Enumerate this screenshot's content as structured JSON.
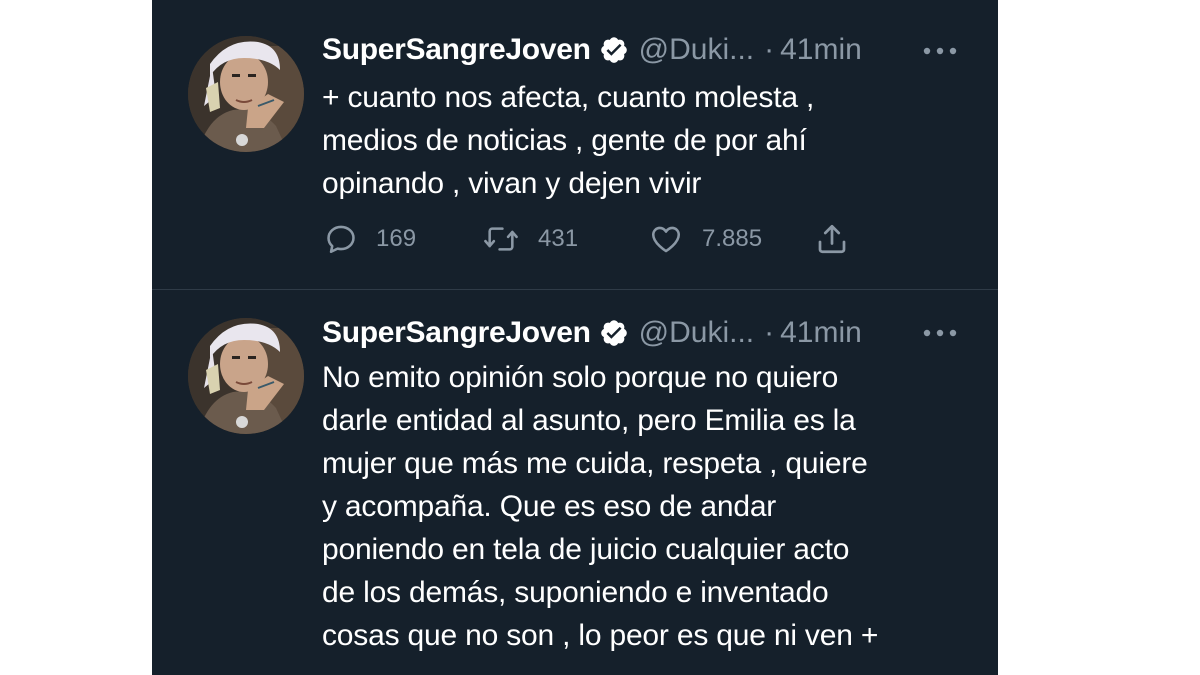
{
  "colors": {
    "background": "#15202b",
    "text_primary": "#ffffff",
    "text_secondary": "#8b98a5",
    "verified_badge": "#ffffff",
    "divider": "#2f3b47"
  },
  "tweets": [
    {
      "author": {
        "display_name": "SuperSangreJoven",
        "verified_icon": "verified-badge-icon",
        "handle": "@Duki...",
        "separator": "·",
        "time": "41min"
      },
      "more_icon": "more-options-icon",
      "text": "+ cuanto nos afecta, cuanto molesta ,\nmedios de noticias , gente de por ahí\nopinando , vivan y dejen vivir",
      "actions": {
        "reply": {
          "icon": "reply-icon",
          "count": "169"
        },
        "retweet": {
          "icon": "retweet-icon",
          "count": "431"
        },
        "like": {
          "icon": "heart-icon",
          "count": "7.885"
        },
        "share": {
          "icon": "share-icon"
        }
      }
    },
    {
      "author": {
        "display_name": "SuperSangreJoven",
        "verified_icon": "verified-badge-icon",
        "handle": "@Duki...",
        "separator": "·",
        "time": "41min"
      },
      "more_icon": "more-options-icon",
      "text": "No emito opinión solo porque no quiero\ndarle entidad al asunto, pero Emilia es la\nmujer que más me cuida, respeta , quiere\ny acompaña. Que es eso de andar\nponiendo en tela de juicio cualquier acto\nde los demás, suponiendo e inventado\ncosas que no son , lo peor es que ni ven +"
    }
  ]
}
